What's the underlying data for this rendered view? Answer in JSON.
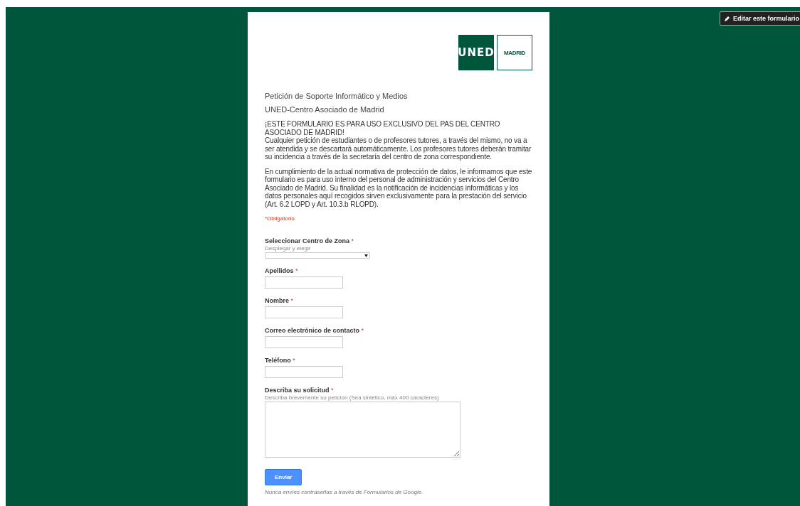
{
  "edit_button": {
    "label": "Editar este formulario"
  },
  "logo": {
    "left": "UNED",
    "right": "MADRID"
  },
  "form": {
    "title": "Petición de Soporte Informático y Medios",
    "subtitle": "UNED-Centro Asociado de Madrid",
    "paragraphs": [
      "¡ESTE FORMULARIO ES PARA USO EXCLUSIVO DEL PAS DEL CENTRO ASOCIADO DE MADRID!\nCualquier petición de estudiantes o de profesores tutores, a través del mismo, no va a ser atendida y se descartará automáticamente. Los profesores tutores deberán tramitar su incidencia a través de la secretaría del centro de zona correspondiente.",
      "En cumplimiento de la actual normativa de protección de datos, le informamos que este formulario es para uso interno del personal de administración y servicios del Centro Asociado de Madrid. Su finalidad es la notificación de incidencias informáticas y los datos personales aquí recogidos sirven exclusivamente para la prestación del servicio (Art. 6.2 LOPD y Art. 10.3.b RLOPD)."
    ],
    "required_note": "*Obligatorio",
    "fields": [
      {
        "kind": "select",
        "label": "Seleccionar Centro de Zona",
        "required_mark": "*",
        "help": "Desplegar y elegir"
      },
      {
        "kind": "text",
        "label": "Apellidos",
        "required_mark": "*"
      },
      {
        "kind": "text",
        "label": "Nombre",
        "required_mark": "*"
      },
      {
        "kind": "text",
        "label": "Correo electrónico de contacto",
        "required_mark": "*"
      },
      {
        "kind": "text",
        "label": "Teléfono",
        "required_mark": "*"
      },
      {
        "kind": "textarea",
        "label": "Describa su solicitud",
        "required_mark": "*",
        "help": "Describa brevemente su petición (Sea sintético, máx 400 caracteres)"
      }
    ],
    "submit": "Enviar",
    "footer": "Nunca envíes contraseñas a través de Formularios de Google."
  }
}
